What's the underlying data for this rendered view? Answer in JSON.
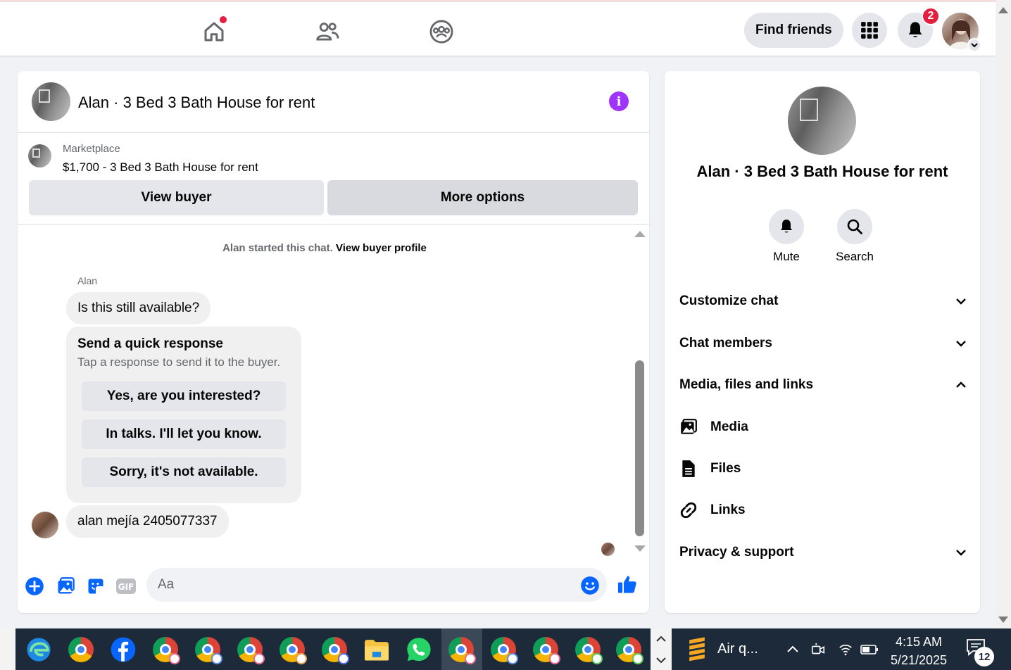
{
  "topbar": {
    "find_friends_label": "Find friends",
    "notification_count": "2",
    "icons": [
      "home-icon",
      "friends-icon",
      "groups-icon",
      "menu-grid-icon",
      "bell-icon"
    ]
  },
  "chat": {
    "title": "Alan · 3 Bed 3 Bath House for rent",
    "marketplace_label": "Marketplace",
    "listing": "$1,700 - 3 Bed 3 Bath House for rent",
    "view_buyer_label": "View buyer",
    "more_options_label": "More options",
    "system_text": "Alan started this chat.",
    "system_link": "View buyer profile",
    "sender_name": "Alan",
    "first_message": "Is this still available?",
    "quick_response": {
      "title": "Send a quick response",
      "subtitle": "Tap a response to send it to the buyer.",
      "options": [
        "Yes, are you interested?",
        "In talks. I'll let you know.",
        "Sorry, it's not available."
      ]
    },
    "second_message": "alan mejía 2405077337",
    "composer_placeholder": "Aa"
  },
  "details": {
    "title": "Alan · 3 Bed 3 Bath House for rent",
    "mute_label": "Mute",
    "search_label": "Search",
    "sections": {
      "customize": "Customize chat",
      "members": "Chat members",
      "media_files_links": "Media, files and links",
      "privacy": "Privacy & support"
    },
    "media_items": {
      "media": "Media",
      "files": "Files",
      "links": "Links"
    }
  },
  "taskbar": {
    "weather_label": "Air q...",
    "time": "4:15 AM",
    "date": "5/21/2025",
    "notification_count": "12"
  },
  "colors": {
    "accent_blue": "#0866ff",
    "info_purple": "#a033ff",
    "badge_red": "#e41e3f",
    "taskbar_bg": "#1c2a3a"
  }
}
